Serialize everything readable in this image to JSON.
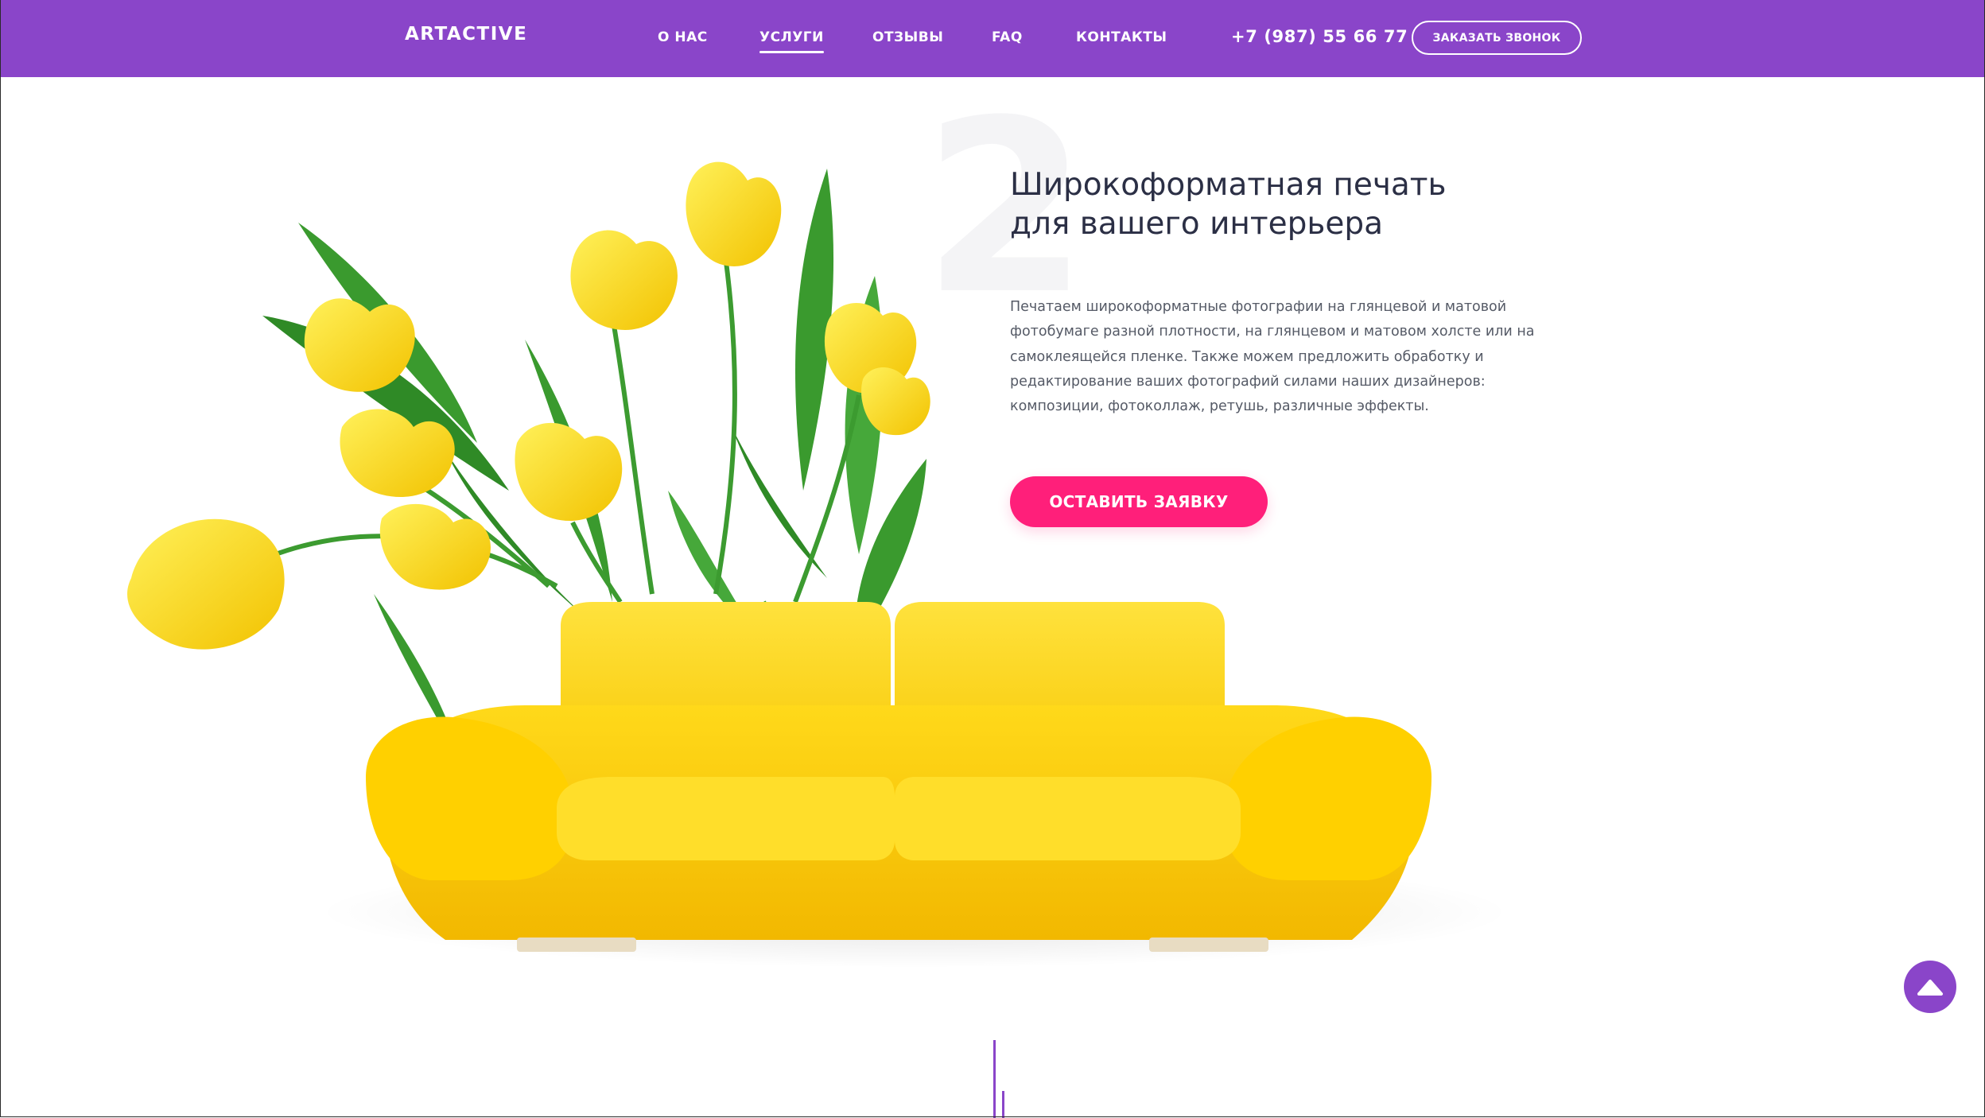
{
  "header": {
    "logo": "ARTACTIVE",
    "nav": [
      {
        "label": "О НАС",
        "active": false
      },
      {
        "label": "УСЛУГИ",
        "active": true
      },
      {
        "label": "ОТЗЫВЫ",
        "active": false
      },
      {
        "label": "FAQ",
        "active": false
      },
      {
        "label": "КОНТАКТЫ",
        "active": false
      }
    ],
    "phone": "+7 (987) 55 66 77",
    "callback_label": "ЗАКАЗАТЬ ЗВОНОК"
  },
  "hero": {
    "watermark": "2",
    "title_line1": "Широкоформатная печать",
    "title_line2": "для вашего интерьера",
    "description": "Печатаем широкоформатные фотографии на глянцевой и матовой фотобумаге разной плотности, на глянцевом и матовом холсте или на самоклеящейся пленке. Также можем предложить обработку и редактирование ваших фотографий силами наших дизайнеров: композиции, фотоколлаж, ретушь, различные эффекты.",
    "cta_label": "ОСТАВИТЬ ЗАЯВКУ"
  },
  "colors": {
    "brand_purple": "#8a45c9",
    "cta_pink": "#ff1f7a",
    "title_text": "#2b2f45",
    "body_text": "#555a66",
    "sofa_yellow": "#fbd000",
    "leaf_green": "#3a9a2e"
  },
  "icons": {
    "scroll_top": "arrow-up-icon"
  }
}
